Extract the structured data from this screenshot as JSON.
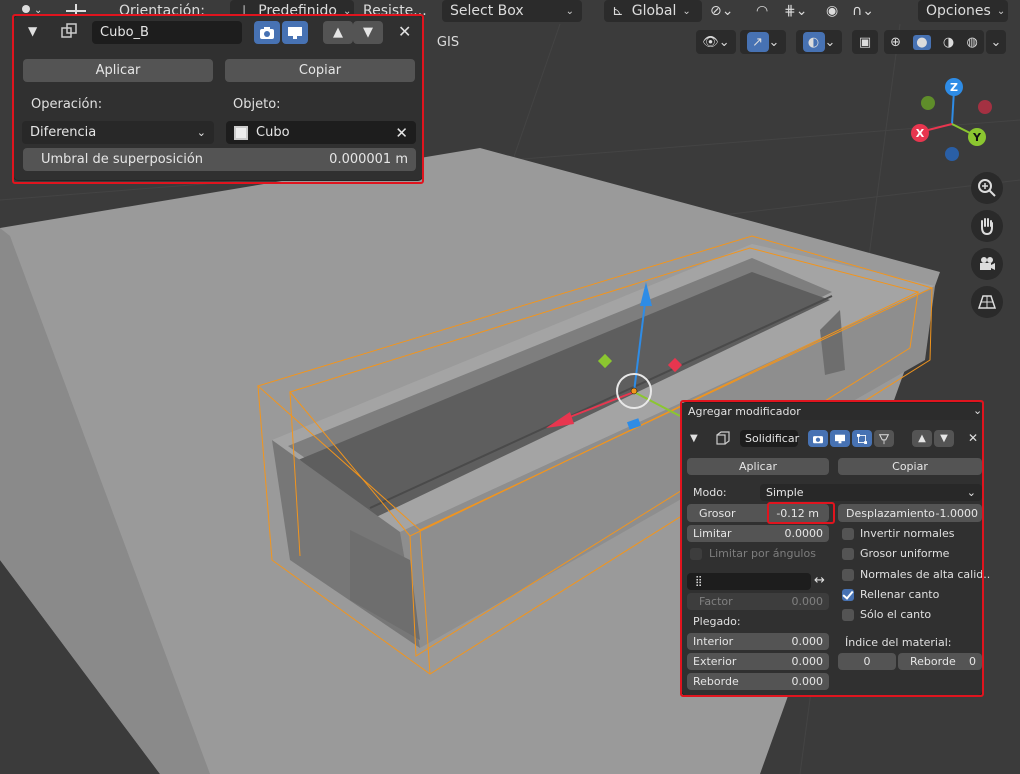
{
  "header": {
    "orientation_label": "Orientación:",
    "transform_preset": "Predefinido",
    "snap_label": "Resiste...",
    "select_mode": "Select Box",
    "transform_space": "Global",
    "options_label": "Opciones",
    "gis_tab": "GIS"
  },
  "boolean_panel": {
    "name": "Cubo_B",
    "apply_label": "Aplicar",
    "copy_label": "Copiar",
    "operation_label": "Operación:",
    "object_label": "Objeto:",
    "operation_value": "Diferencia",
    "object_value": "Cubo",
    "overlap_label": "Umbral de superposición",
    "overlap_value": "0.000001 m"
  },
  "solidify_panel": {
    "add_modifier_label": "Agregar modificador",
    "name": "Solidificar",
    "apply_label": "Aplicar",
    "copy_label": "Copiar",
    "mode_label": "Modo:",
    "mode_value": "Simple",
    "thickness_label": "Grosor",
    "thickness_value": "-0.12 m",
    "offset_label": "Desplazamiento",
    "offset_value": "-1.0000",
    "limit_label": "Limitar",
    "limit_value": "0.0000",
    "limit_angles_label": "Limitar por ángulos",
    "factor_label": "Factor",
    "factor_value": "0.000",
    "fold_label": "Plegado:",
    "inner_label": "Interior",
    "inner_value": "0.000",
    "outer_label": "Exterior",
    "outer_value": "0.000",
    "rim_label": "Reborde",
    "rim_value": "0.000",
    "checkboxes": [
      {
        "label": "Invertir normales",
        "checked": false
      },
      {
        "label": "Grosor uniforme",
        "checked": false
      },
      {
        "label": "Normales de alta calid..",
        "checked": false
      },
      {
        "label": "Rellenar canto",
        "checked": true
      },
      {
        "label": "Sólo el canto",
        "checked": false
      }
    ],
    "material_index_label": "Índice del material:",
    "material_index_value": "0",
    "material_rim_label": "Reborde",
    "material_rim_value": "0"
  },
  "gizmo": {
    "z": "Z",
    "x": "X",
    "y": "Y",
    "colors": {
      "x": "#e8364f",
      "y": "#8bc630",
      "z": "#2e8ce6"
    }
  },
  "colors": {
    "accent": "#4772b3",
    "highlight": "#e0141e",
    "selection": "#f2951d"
  }
}
